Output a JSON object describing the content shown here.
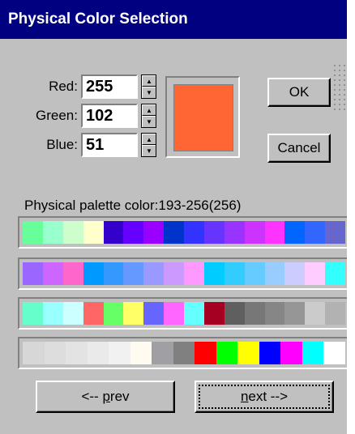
{
  "window": {
    "title": "Physical Color Selection"
  },
  "rgb": {
    "red": {
      "label": "Red:",
      "value": "255"
    },
    "green": {
      "label": "Green:",
      "value": "102"
    },
    "blue": {
      "label": "Blue:",
      "value": "51"
    }
  },
  "preview": {
    "color": "#ff6633"
  },
  "buttons": {
    "ok": "OK",
    "cancel": "Cancel",
    "prev_prefix": "<-- ",
    "prev_accel": "p",
    "prev_rest": "rev",
    "next_accel": "n",
    "next_rest": "ext -->"
  },
  "palette": {
    "label": "Physical palette color:193-256(256)",
    "rows": [
      [
        "#66ff99",
        "#99ffcc",
        "#ccffcc",
        "#ffffcc",
        "#3300cc",
        "#6600ff",
        "#9900ff",
        "#0033cc",
        "#3333ff",
        "#6633ff",
        "#9933ff",
        "#cc33ff",
        "#ff33ff",
        "#0066ff",
        "#3366ff",
        "#6666cc"
      ],
      [
        "#9966ff",
        "#cc66ff",
        "#ff66cc",
        "#0099ff",
        "#3399ff",
        "#6699ff",
        "#9999ff",
        "#cc99ff",
        "#ff99ff",
        "#00ccff",
        "#33ccff",
        "#66ccff",
        "#99ccff",
        "#ccccff",
        "#ffccff",
        "#33ffff"
      ],
      [
        "#66ffcc",
        "#99ffff",
        "#ccffff",
        "#ff6666",
        "#66ff66",
        "#ffff66",
        "#6666ff",
        "#ff66ff",
        "#66ffff",
        "#a50021",
        "#5f5f5f",
        "#777777",
        "#868686",
        "#969696",
        "#cbcbcb",
        "#b2b2b2"
      ],
      [
        "#d7d7d7",
        "#dddddd",
        "#e3e3e3",
        "#eaeaea",
        "#f1f1f1",
        "#fffbf0",
        "#a0a0a4",
        "#808080",
        "#ff0000",
        "#00ff00",
        "#ffff00",
        "#0000ff",
        "#ff00ff",
        "#00ffff",
        "#ffffff"
      ]
    ]
  }
}
